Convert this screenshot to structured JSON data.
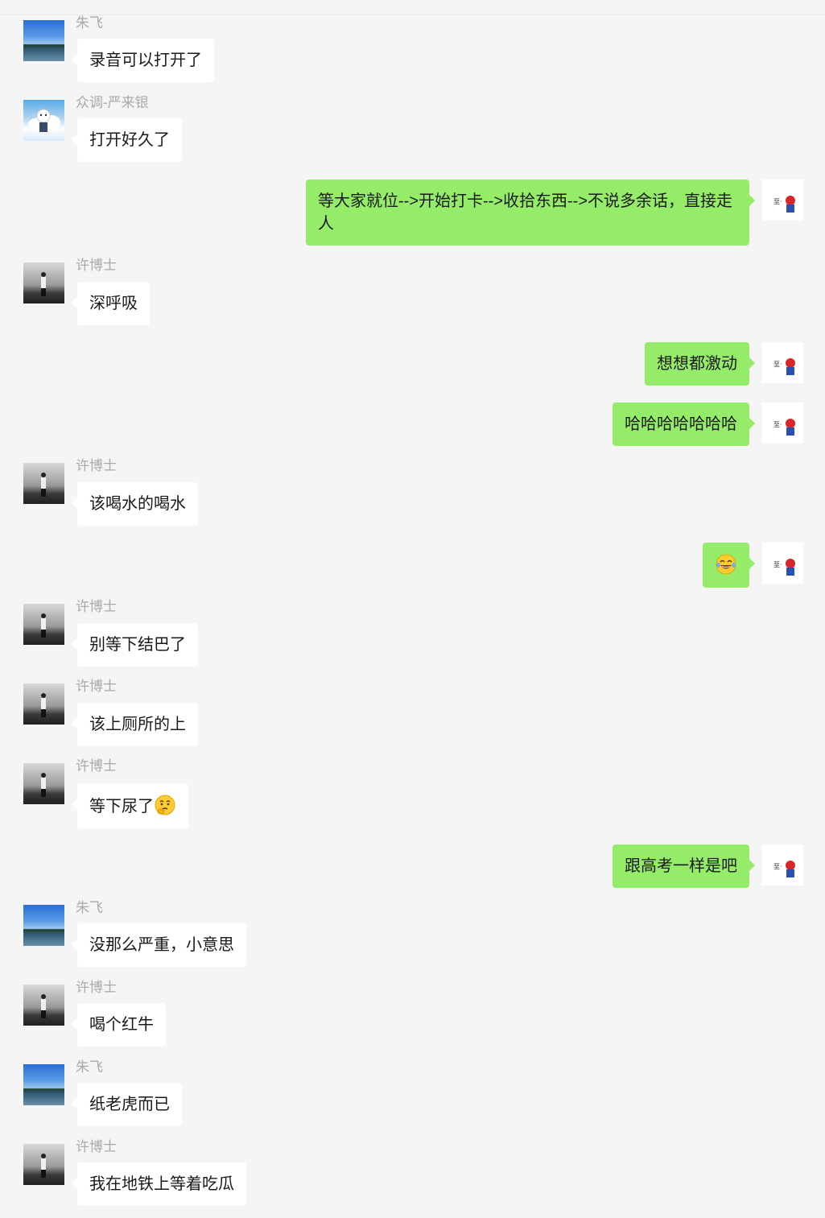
{
  "senders": {
    "zhufei": "朱飞",
    "zhongdiao": "众调-严来银",
    "xuboshi": "许博士"
  },
  "messages": [
    {
      "side": "left",
      "name": "朱飞",
      "text": "录音可以打开了"
    },
    {
      "side": "left",
      "name": "众调-严来银",
      "text": "打开好久了"
    },
    {
      "side": "right",
      "text": "等大家就位-->开始打卡-->收拾东西-->不说多余话，直接走人"
    },
    {
      "side": "left",
      "name": "许博士",
      "text": "深呼吸"
    },
    {
      "side": "right",
      "text": "想想都激动"
    },
    {
      "side": "right",
      "text": "哈哈哈哈哈哈哈"
    },
    {
      "side": "left",
      "name": "许博士",
      "text": "该喝水的喝水"
    },
    {
      "side": "right",
      "text": "",
      "emoji": "tears-of-joy"
    },
    {
      "side": "left",
      "name": "许博士",
      "text": "别等下结巴了"
    },
    {
      "side": "left",
      "name": "许博士",
      "text": "该上厕所的上"
    },
    {
      "side": "left",
      "name": "许博士",
      "text": "等下尿了",
      "emoji": "thinking-face"
    },
    {
      "side": "right",
      "text": "跟高考一样是吧"
    },
    {
      "side": "left",
      "name": "朱飞",
      "text": "没那么严重，小意思"
    },
    {
      "side": "left",
      "name": "许博士",
      "text": "喝个红牛"
    },
    {
      "side": "left",
      "name": "朱飞",
      "text": "纸老虎而已"
    },
    {
      "side": "left",
      "name": "许博士",
      "text": "我在地铁上等着吃瓜"
    }
  ],
  "colors": {
    "background": "#f5f5f5",
    "bubble_left": "#ffffff",
    "bubble_right": "#95ec69",
    "sender_name": "#a9a9a9"
  }
}
